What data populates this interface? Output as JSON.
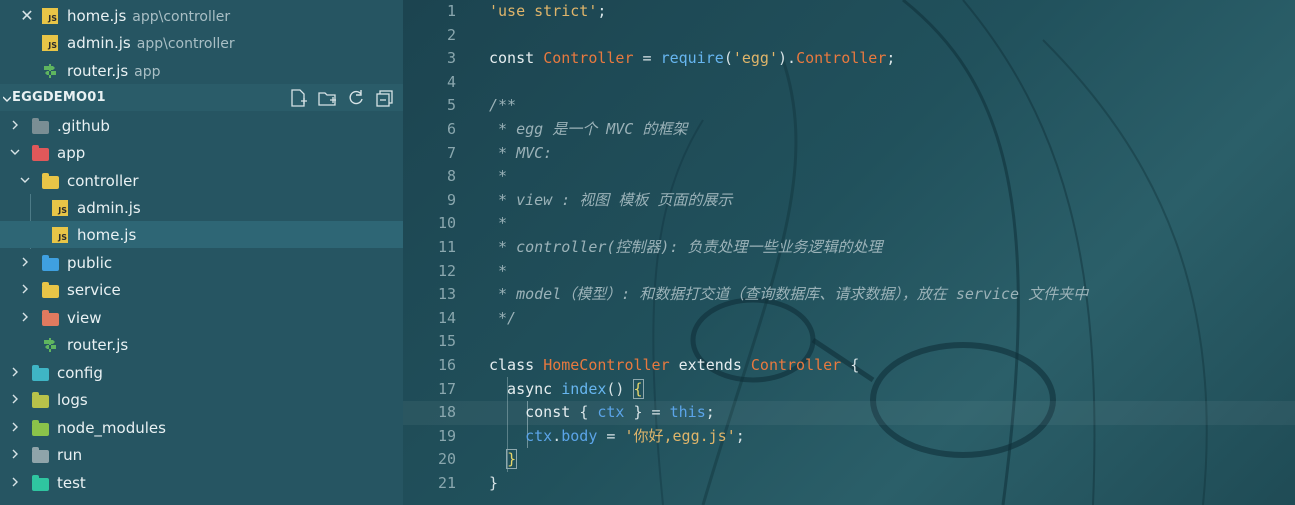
{
  "colors": {
    "sidebar_bg": "#265562",
    "selected_row": "#2e6675",
    "editor_bg": "#1f4650",
    "string": "#e0b56a",
    "class_name": "#e8793f",
    "function_name": "#67b6f0",
    "comment": "#9bb2b8"
  },
  "open_editors": [
    {
      "name": "home.js",
      "path": "app\\controller",
      "icon": "js-icon"
    },
    {
      "name": "admin.js",
      "path": "app\\controller",
      "icon": "js-icon"
    },
    {
      "name": "router.js",
      "path": "app",
      "icon": "router-icon"
    }
  ],
  "explorer": {
    "title": "EGGDEMO01",
    "actions": [
      "new-file-icon",
      "new-folder-icon",
      "refresh-icon",
      "collapse-all-icon"
    ],
    "tree": [
      {
        "label": ".github",
        "icon": "github-folder-icon",
        "expanded": false
      },
      {
        "label": "app",
        "icon": "app-folder-icon",
        "expanded": true
      },
      {
        "label": "controller",
        "icon": "controller-folder-icon",
        "expanded": true
      },
      {
        "label": "admin.js",
        "icon": "js-icon"
      },
      {
        "label": "home.js",
        "icon": "js-icon",
        "selected": true
      },
      {
        "label": "public",
        "icon": "public-folder-icon",
        "expanded": false
      },
      {
        "label": "service",
        "icon": "service-folder-icon",
        "expanded": false
      },
      {
        "label": "view",
        "icon": "view-folder-icon",
        "expanded": false
      },
      {
        "label": "router.js",
        "icon": "router-icon"
      },
      {
        "label": "config",
        "icon": "config-folder-icon",
        "expanded": false
      },
      {
        "label": "logs",
        "icon": "logs-folder-icon",
        "expanded": false
      },
      {
        "label": "node_modules",
        "icon": "node-modules-folder-icon",
        "expanded": false
      },
      {
        "label": "run",
        "icon": "run-folder-icon",
        "expanded": false
      },
      {
        "label": "test",
        "icon": "test-folder-icon",
        "expanded": false
      }
    ]
  },
  "editor": {
    "current_line": 18,
    "lines": [
      {
        "n": "1",
        "tokens": [
          [
            "str",
            "'use strict'"
          ],
          [
            "op",
            ";"
          ]
        ]
      },
      {
        "n": "2",
        "tokens": []
      },
      {
        "n": "3",
        "tokens": [
          [
            "kw",
            "const "
          ],
          [
            "cls",
            "Controller"
          ],
          [
            "op",
            " = "
          ],
          [
            "fn",
            "require"
          ],
          [
            "op",
            "("
          ],
          [
            "str",
            "'egg'"
          ],
          [
            "op",
            ")."
          ],
          [
            "cls",
            "Controller"
          ],
          [
            "op",
            ";"
          ]
        ]
      },
      {
        "n": "4",
        "tokens": []
      },
      {
        "n": "5",
        "tokens": [
          [
            "com",
            "/**"
          ]
        ]
      },
      {
        "n": "6",
        "tokens": [
          [
            "com",
            " * egg 是一个 MVC 的框架"
          ]
        ]
      },
      {
        "n": "7",
        "tokens": [
          [
            "com",
            " * MVC:"
          ]
        ]
      },
      {
        "n": "8",
        "tokens": [
          [
            "com",
            " *"
          ]
        ]
      },
      {
        "n": "9",
        "tokens": [
          [
            "com",
            " * view : 视图 模板 页面的展示"
          ]
        ]
      },
      {
        "n": "10",
        "tokens": [
          [
            "com",
            " *"
          ]
        ]
      },
      {
        "n": "11",
        "tokens": [
          [
            "com",
            " * controller(控制器): 负责处理一些业务逻辑的处理"
          ]
        ]
      },
      {
        "n": "12",
        "tokens": [
          [
            "com",
            " *"
          ]
        ]
      },
      {
        "n": "13",
        "tokens": [
          [
            "com",
            " * model（模型）: 和数据打交道（查询数据库、请求数据），放在 service 文件夹中"
          ]
        ]
      },
      {
        "n": "14",
        "tokens": [
          [
            "com",
            " */"
          ]
        ]
      },
      {
        "n": "15",
        "tokens": []
      },
      {
        "n": "16",
        "tokens": [
          [
            "kw",
            "class "
          ],
          [
            "cls",
            "HomeController"
          ],
          [
            "kw",
            " extends "
          ],
          [
            "cls",
            "Controller"
          ],
          [
            "op",
            " {"
          ]
        ]
      },
      {
        "n": "17",
        "tokens": [
          [
            "kw",
            "  async "
          ],
          [
            "fn",
            "index"
          ],
          [
            "op",
            "() "
          ],
          [
            "brace",
            "{"
          ]
        ]
      },
      {
        "n": "18",
        "tokens": [
          [
            "kw",
            "    const "
          ],
          [
            "op",
            "{ "
          ],
          [
            "var",
            "ctx"
          ],
          [
            "op",
            " } = "
          ],
          [
            "this",
            "this"
          ],
          [
            "op",
            ";"
          ]
        ]
      },
      {
        "n": "19",
        "tokens": [
          [
            "var",
            "    ctx"
          ],
          [
            "op",
            "."
          ],
          [
            "prop",
            "body"
          ],
          [
            "op",
            " = "
          ],
          [
            "str",
            "'你好,egg.js'"
          ],
          [
            "op",
            ";"
          ]
        ]
      },
      {
        "n": "20",
        "tokens": [
          [
            "op",
            "  "
          ],
          [
            "brace",
            "}"
          ]
        ]
      },
      {
        "n": "21",
        "tokens": [
          [
            "op",
            "}"
          ]
        ]
      }
    ]
  }
}
